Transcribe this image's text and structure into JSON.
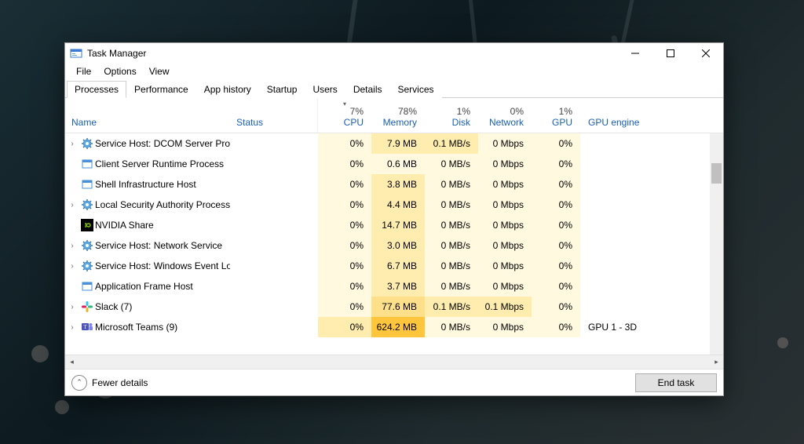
{
  "window": {
    "title": "Task Manager"
  },
  "menu": {
    "file": "File",
    "options": "Options",
    "view": "View"
  },
  "tabs": [
    {
      "label": "Processes",
      "active": true
    },
    {
      "label": "Performance",
      "active": false
    },
    {
      "label": "App history",
      "active": false
    },
    {
      "label": "Startup",
      "active": false
    },
    {
      "label": "Users",
      "active": false
    },
    {
      "label": "Details",
      "active": false
    },
    {
      "label": "Services",
      "active": false
    }
  ],
  "columns": {
    "name": "Name",
    "status": "Status",
    "cpu": {
      "pct": "7%",
      "label": "CPU"
    },
    "memory": {
      "pct": "78%",
      "label": "Memory"
    },
    "disk": {
      "pct": "1%",
      "label": "Disk"
    },
    "network": {
      "pct": "0%",
      "label": "Network"
    },
    "gpu": {
      "pct": "1%",
      "label": "GPU"
    },
    "gpu_engine": "GPU engine"
  },
  "rows": [
    {
      "expand": true,
      "icon": "gear",
      "name": "Service Host: DCOM Server Proc...",
      "cpu": "0%",
      "mem": "7.9 MB",
      "disk": "0.1 MB/s",
      "net": "0 Mbps",
      "gpu": "0%",
      "gpueng": "",
      "heat": {
        "cpu": 0,
        "mem": 1,
        "disk": 1,
        "net": 0,
        "gpu": 0
      }
    },
    {
      "expand": false,
      "icon": "window",
      "name": "Client Server Runtime Process",
      "cpu": "0%",
      "mem": "0.6 MB",
      "disk": "0 MB/s",
      "net": "0 Mbps",
      "gpu": "0%",
      "gpueng": "",
      "heat": {
        "cpu": 0,
        "mem": 0,
        "disk": 0,
        "net": 0,
        "gpu": 0
      }
    },
    {
      "expand": false,
      "icon": "window",
      "name": "Shell Infrastructure Host",
      "cpu": "0%",
      "mem": "3.8 MB",
      "disk": "0 MB/s",
      "net": "0 Mbps",
      "gpu": "0%",
      "gpueng": "",
      "heat": {
        "cpu": 0,
        "mem": 1,
        "disk": 0,
        "net": 0,
        "gpu": 0
      }
    },
    {
      "expand": true,
      "icon": "gear",
      "name": "Local Security Authority Process...",
      "cpu": "0%",
      "mem": "4.4 MB",
      "disk": "0 MB/s",
      "net": "0 Mbps",
      "gpu": "0%",
      "gpueng": "",
      "heat": {
        "cpu": 0,
        "mem": 1,
        "disk": 0,
        "net": 0,
        "gpu": 0
      }
    },
    {
      "expand": false,
      "icon": "nvidia",
      "name": "NVIDIA Share",
      "cpu": "0%",
      "mem": "14.7 MB",
      "disk": "0 MB/s",
      "net": "0 Mbps",
      "gpu": "0%",
      "gpueng": "",
      "heat": {
        "cpu": 0,
        "mem": 1,
        "disk": 0,
        "net": 0,
        "gpu": 0
      }
    },
    {
      "expand": true,
      "icon": "gear",
      "name": "Service Host: Network Service",
      "cpu": "0%",
      "mem": "3.0 MB",
      "disk": "0 MB/s",
      "net": "0 Mbps",
      "gpu": "0%",
      "gpueng": "",
      "heat": {
        "cpu": 0,
        "mem": 1,
        "disk": 0,
        "net": 0,
        "gpu": 0
      }
    },
    {
      "expand": true,
      "icon": "gear",
      "name": "Service Host: Windows Event Log",
      "cpu": "0%",
      "mem": "6.7 MB",
      "disk": "0 MB/s",
      "net": "0 Mbps",
      "gpu": "0%",
      "gpueng": "",
      "heat": {
        "cpu": 0,
        "mem": 1,
        "disk": 0,
        "net": 0,
        "gpu": 0
      }
    },
    {
      "expand": false,
      "icon": "window",
      "name": "Application Frame Host",
      "cpu": "0%",
      "mem": "3.7 MB",
      "disk": "0 MB/s",
      "net": "0 Mbps",
      "gpu": "0%",
      "gpueng": "",
      "heat": {
        "cpu": 0,
        "mem": 1,
        "disk": 0,
        "net": 0,
        "gpu": 0
      }
    },
    {
      "expand": true,
      "icon": "slack",
      "name": "Slack (7)",
      "cpu": "0%",
      "mem": "77.6 MB",
      "disk": "0.1 MB/s",
      "net": "0.1 Mbps",
      "gpu": "0%",
      "gpueng": "",
      "heat": {
        "cpu": 0,
        "mem": 2,
        "disk": 1,
        "net": 1,
        "gpu": 0
      }
    },
    {
      "expand": true,
      "icon": "teams",
      "name": "Microsoft Teams (9)",
      "cpu": "0%",
      "mem": "624.2 MB",
      "disk": "0 MB/s",
      "net": "0 Mbps",
      "gpu": "0%",
      "gpueng": "GPU 1 - 3D",
      "heat": {
        "cpu": 1,
        "mem": 4,
        "disk": 0,
        "net": 0,
        "gpu": 0
      }
    }
  ],
  "footer": {
    "fewer_details": "Fewer details",
    "end_task": "End task"
  },
  "icons": {
    "gear": "gear-icon",
    "window": "window-icon",
    "nvidia": "nvidia-icon",
    "slack": "slack-icon",
    "teams": "teams-icon"
  },
  "colors": {
    "heat0": "#fff9e0",
    "heat1": "#ffedb0",
    "heat2": "#ffe08a",
    "heat3": "#ffd36b",
    "heat4": "#ffc53d"
  }
}
